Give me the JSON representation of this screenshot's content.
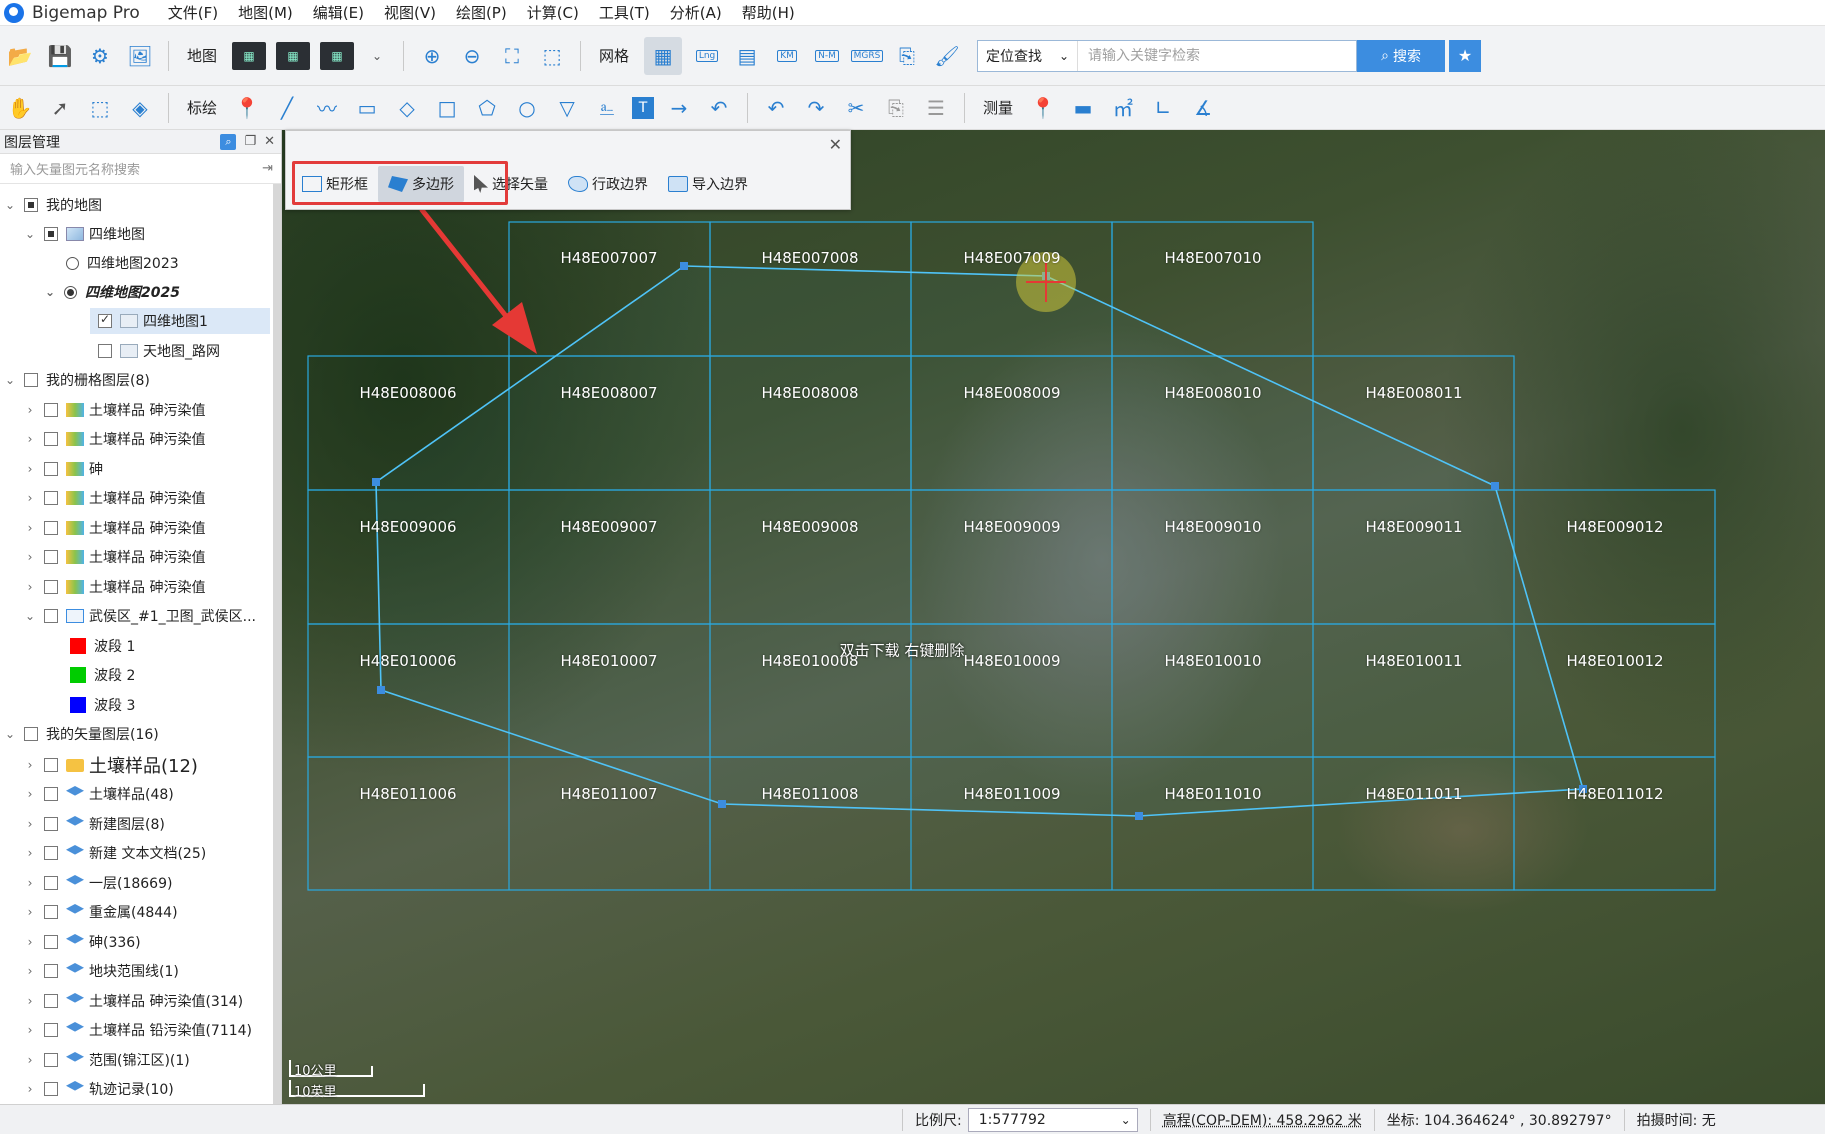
{
  "app": {
    "title": "Bigemap Pro"
  },
  "menu": [
    "文件(F)",
    "地图(M)",
    "编辑(E)",
    "视图(V)",
    "绘图(P)",
    "计算(C)",
    "工具(T)",
    "分析(A)",
    "帮助(H)"
  ],
  "toolbar1": {
    "map_label": "地图",
    "grid_label": "网格",
    "search_mode": "定位查找",
    "search_placeholder": "请输入关键字检索",
    "search_button": "搜索",
    "badges": {
      "lng": "Lng",
      "km": "KM",
      "nm": "N-M",
      "mgrs": "MGRS"
    }
  },
  "toolbar2": {
    "annotate_label": "标绘",
    "measure_label": "测量"
  },
  "sidebar": {
    "title": "图层管理",
    "filter_placeholder": "输入矢量图元名称搜索",
    "rows": [
      {
        "label": "我的地图"
      },
      {
        "label": "四维地图"
      },
      {
        "label": "四维地图2023"
      },
      {
        "label": "四维地图2025"
      },
      {
        "label": "四维地图1"
      },
      {
        "label": "天地图_路网"
      },
      {
        "label": "我的栅格图层(8)"
      },
      {
        "label": "土壤样品 砷污染值"
      },
      {
        "label": "土壤样品 砷污染值"
      },
      {
        "label": "砷"
      },
      {
        "label": "土壤样品 砷污染值"
      },
      {
        "label": "土壤样品 砷污染值"
      },
      {
        "label": "土壤样品 砷污染值"
      },
      {
        "label": "土壤样品 砷污染值"
      },
      {
        "label": "武侯区_#1_卫图_武侯区..."
      },
      {
        "label": "波段 1",
        "color": "#ff0000"
      },
      {
        "label": "波段 2",
        "color": "#00cc00"
      },
      {
        "label": "波段 3",
        "color": "#0000ff"
      },
      {
        "label": "我的矢量图层(16)"
      },
      {
        "label": "土壤样品(12)"
      },
      {
        "label": "土壤样品(48)"
      },
      {
        "label": "新建图层(8)"
      },
      {
        "label": "新建 文本文档(25)"
      },
      {
        "label": "一层(18669)"
      },
      {
        "label": "重金属(4844)"
      },
      {
        "label": "砷(336)"
      },
      {
        "label": "地块范围线(1)"
      },
      {
        "label": "土壤样品 砷污染值(314)"
      },
      {
        "label": "土壤样品 铅污染值(7114)"
      },
      {
        "label": "范围(锦江区)(1)"
      },
      {
        "label": "轨迹记录(10)"
      }
    ]
  },
  "draw_panel": {
    "tools": [
      "矩形框",
      "多边形",
      "选择矢量",
      "行政边界",
      "导入边界"
    ],
    "selected": "多边形"
  },
  "map": {
    "tiles": [
      "H48E007007",
      "H48E007008",
      "H48E007009",
      "H48E007010",
      "H48E008006",
      "H48E008007",
      "H48E008008",
      "H48E008009",
      "H48E008010",
      "H48E008011",
      "H48E009006",
      "H48E009007",
      "H48E009008",
      "H48E009009",
      "H48E009010",
      "H48E009011",
      "H48E009012",
      "H48E010006",
      "H48E010007",
      "H48E010008",
      "H48E010009",
      "H48E010010",
      "H48E010011",
      "H48E010012",
      "H48E011006",
      "H48E011007",
      "H48E011008",
      "H48E011009",
      "H48E011010",
      "H48E011011",
      "H48E011012"
    ],
    "hint": "双击下载 右键删除",
    "grid_color": "#29a9e0",
    "polygon_color": "#4fc3f7",
    "arrow_color": "#e53935"
  },
  "scalebar": {
    "metric": "10公里",
    "imperial": "10英里"
  },
  "status": {
    "scale_label": "比例尺:",
    "scale_value": "1:577792",
    "elevation": "高程(COP-DEM): 458.2962 米",
    "coords": "坐标: 104.364624° , 30.892797°",
    "capture_time": "拍摄时间: 无"
  }
}
